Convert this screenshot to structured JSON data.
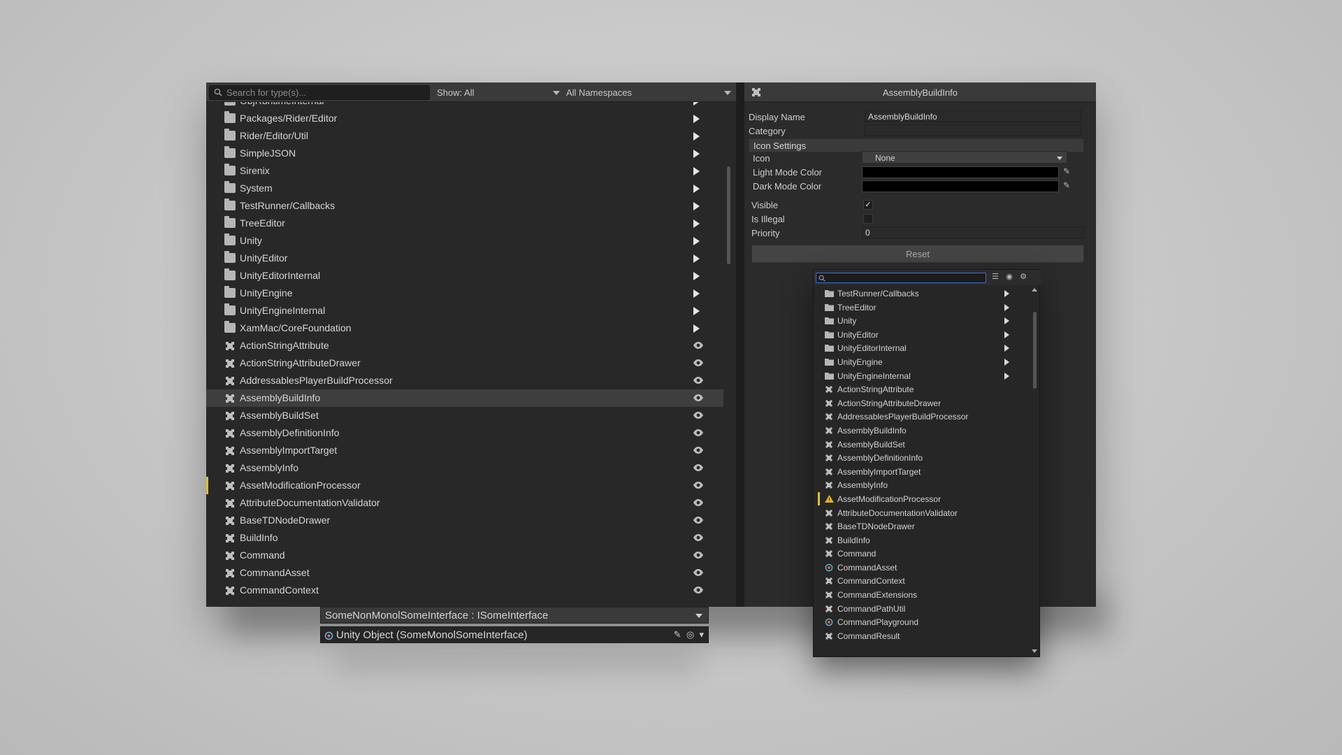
{
  "toolbar": {
    "search_placeholder": "Search for type(s)...",
    "show_filter": "Show: All",
    "namespace_filter": "All Namespaces"
  },
  "tree": {
    "items": [
      {
        "label": "ObjRuntimeInternal",
        "kind": "folder"
      },
      {
        "label": "Packages/Rider/Editor",
        "kind": "folder"
      },
      {
        "label": "Rider/Editor/Util",
        "kind": "folder"
      },
      {
        "label": "SimpleJSON",
        "kind": "folder"
      },
      {
        "label": "Sirenix",
        "kind": "folder"
      },
      {
        "label": "System",
        "kind": "folder"
      },
      {
        "label": "TestRunner/Callbacks",
        "kind": "folder"
      },
      {
        "label": "TreeEditor",
        "kind": "folder"
      },
      {
        "label": "Unity",
        "kind": "folder"
      },
      {
        "label": "UnityEditor",
        "kind": "folder"
      },
      {
        "label": "UnityEditorInternal",
        "kind": "folder"
      },
      {
        "label": "UnityEngine",
        "kind": "folder"
      },
      {
        "label": "UnityEngineInternal",
        "kind": "folder"
      },
      {
        "label": "XamMac/CoreFoundation",
        "kind": "folder"
      },
      {
        "label": "ActionStringAttribute",
        "kind": "type"
      },
      {
        "label": "ActionStringAttributeDrawer",
        "kind": "type"
      },
      {
        "label": "AddressablesPlayerBuildProcessor",
        "kind": "type"
      },
      {
        "label": "AssemblyBuildInfo",
        "kind": "type",
        "selected": true
      },
      {
        "label": "AssemblyBuildSet",
        "kind": "type"
      },
      {
        "label": "AssemblyDefinitionInfo",
        "kind": "type"
      },
      {
        "label": "AssemblyImportTarget",
        "kind": "type"
      },
      {
        "label": "AssemblyInfo",
        "kind": "type"
      },
      {
        "label": "AssetModificationProcessor",
        "kind": "type",
        "warning": true
      },
      {
        "label": "AttributeDocumentationValidator",
        "kind": "type"
      },
      {
        "label": "BaseTDNodeDrawer",
        "kind": "type"
      },
      {
        "label": "BuildInfo",
        "kind": "type"
      },
      {
        "label": "Command",
        "kind": "type"
      },
      {
        "label": "CommandAsset",
        "kind": "type"
      },
      {
        "label": "CommandContext",
        "kind": "type"
      }
    ]
  },
  "inspector": {
    "title": "AssemblyBuildInfo",
    "display_name_label": "Display Name",
    "display_name_value": "AssemblyBuildInfo",
    "category_label": "Category",
    "category_value": "",
    "icon_settings_label": "Icon Settings",
    "icon_label": "Icon",
    "icon_value": "None",
    "light_mode_color_label": "Light Mode Color",
    "dark_mode_color_label": "Dark Mode Color",
    "visible_label": "Visible",
    "visible_checked": "✓",
    "is_illegal_label": "Is Illegal",
    "priority_label": "Priority",
    "priority_value": "0",
    "reset_label": "Reset",
    "light_color": "#000000",
    "dark_color": "#000000"
  },
  "popup": {
    "items": [
      {
        "label": "TestRunner/Callbacks",
        "kind": "folder"
      },
      {
        "label": "TreeEditor",
        "kind": "folder"
      },
      {
        "label": "Unity",
        "kind": "folder"
      },
      {
        "label": "UnityEditor",
        "kind": "folder"
      },
      {
        "label": "UnityEditorInternal",
        "kind": "folder"
      },
      {
        "label": "UnityEngine",
        "kind": "folder"
      },
      {
        "label": "UnityEngineInternal",
        "kind": "folder"
      },
      {
        "label": "ActionStringAttribute",
        "kind": "type"
      },
      {
        "label": "ActionStringAttributeDrawer",
        "kind": "type"
      },
      {
        "label": "AddressablesPlayerBuildProcessor",
        "kind": "type"
      },
      {
        "label": "AssemblyBuildInfo",
        "kind": "type"
      },
      {
        "label": "AssemblyBuildSet",
        "kind": "type"
      },
      {
        "label": "AssemblyDefinitionInfo",
        "kind": "type"
      },
      {
        "label": "AssemblyImportTarget",
        "kind": "type"
      },
      {
        "label": "AssemblyInfo",
        "kind": "type"
      },
      {
        "label": "AssetModificationProcessor",
        "kind": "warning"
      },
      {
        "label": "AttributeDocumentationValidator",
        "kind": "type"
      },
      {
        "label": "BaseTDNodeDrawer",
        "kind": "type"
      },
      {
        "label": "BuildInfo",
        "kind": "type"
      },
      {
        "label": "Command",
        "kind": "type"
      },
      {
        "label": "CommandAsset",
        "kind": "unity"
      },
      {
        "label": "CommandContext",
        "kind": "type"
      },
      {
        "label": "CommandExtensions",
        "kind": "type"
      },
      {
        "label": "CommandPathUtil",
        "kind": "type"
      },
      {
        "label": "CommandPlayground",
        "kind": "unity"
      },
      {
        "label": "CommandResult",
        "kind": "type"
      }
    ]
  },
  "field_widget": {
    "type_label": "SomeNonMonolSomeInterface : ISomeInterface",
    "object_label": "Unity Object (SomeMonolSomeInterface)"
  },
  "colors": {
    "accent_warning": "#d9c13b",
    "search_focus": "#3f6ed8",
    "panel_bg": "#282828"
  }
}
